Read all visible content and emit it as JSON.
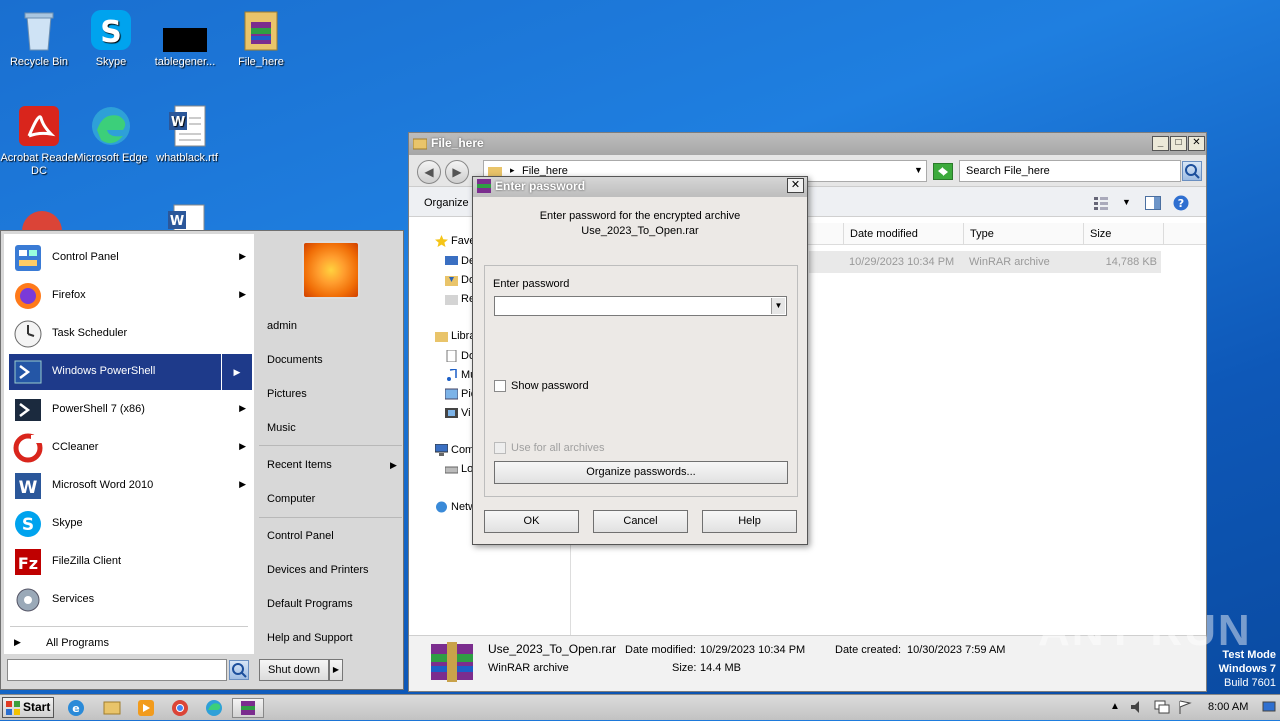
{
  "desktop": {
    "icons": [
      {
        "label": "Recycle Bin"
      },
      {
        "label": "Skype"
      },
      {
        "label": "tablegener..."
      },
      {
        "label": "File_here"
      },
      {
        "label": "Acrobat Reader DC"
      },
      {
        "label": "Microsoft Edge"
      },
      {
        "label": "whatblack.rtf"
      }
    ]
  },
  "explorer": {
    "title": "File_here",
    "breadcrumb": "File_here",
    "search_placeholder": "Search File_here",
    "organize_label": "Organize",
    "columns": [
      "Date modified",
      "Type",
      "Size"
    ],
    "file_row": {
      "date": "10/29/2023 10:34 PM",
      "type": "WinRAR archive",
      "size": "14,788 KB"
    },
    "nav": {
      "favorites": "Fave",
      "fav_items": [
        "De",
        "Do",
        "Re"
      ],
      "libraries": "Libra",
      "lib_items": [
        "Do",
        "Mu",
        "Pic",
        "Vi"
      ],
      "computer": "Com",
      "comp_items": [
        "Lo"
      ],
      "network": "Netw"
    },
    "details": {
      "filename": "Use_2023_To_Open.rar",
      "modified_label": "Date modified:",
      "modified_value": "10/29/2023 10:34 PM",
      "created_label": "Date created:",
      "created_value": "10/30/2023 7:59 AM",
      "type": "WinRAR archive",
      "size_label": "Size:",
      "size_value": "14.4 MB"
    }
  },
  "dialog": {
    "title": "Enter password",
    "message_line1": "Enter password for the encrypted archive",
    "message_line2": "Use_2023_To_Open.rar",
    "password_label": "Enter password",
    "password_value": "",
    "show_password_label": "Show password",
    "use_all_label": "Use for all archives",
    "organize_button": "Organize passwords...",
    "ok_button": "OK",
    "cancel_button": "Cancel",
    "help_button": "Help"
  },
  "startmenu": {
    "programs": [
      {
        "label": "Control Panel",
        "arrow": true
      },
      {
        "label": "Firefox",
        "arrow": true
      },
      {
        "label": "Task Scheduler",
        "arrow": false
      },
      {
        "label": "Windows PowerShell",
        "arrow": true
      },
      {
        "label": "PowerShell 7 (x86)",
        "arrow": true
      },
      {
        "label": "CCleaner",
        "arrow": true
      },
      {
        "label": "Microsoft Word 2010",
        "arrow": true
      },
      {
        "label": "Skype",
        "arrow": false
      },
      {
        "label": "FileZilla Client",
        "arrow": false
      },
      {
        "label": "Services",
        "arrow": false
      }
    ],
    "all_programs": "All Programs",
    "right": [
      "admin",
      "Documents",
      "Pictures",
      "Music",
      "Recent Items",
      "Computer",
      "Control Panel",
      "Devices and Printers",
      "Default Programs",
      "Help and Support"
    ],
    "shutdown": "Shut down"
  },
  "taskbar": {
    "start_label": "Start",
    "clock": "8:00 AM"
  },
  "watermark": {
    "brand": "ANY RUN",
    "line1": "Test Mode",
    "line2": "Windows 7",
    "line3": "Build 7601"
  }
}
